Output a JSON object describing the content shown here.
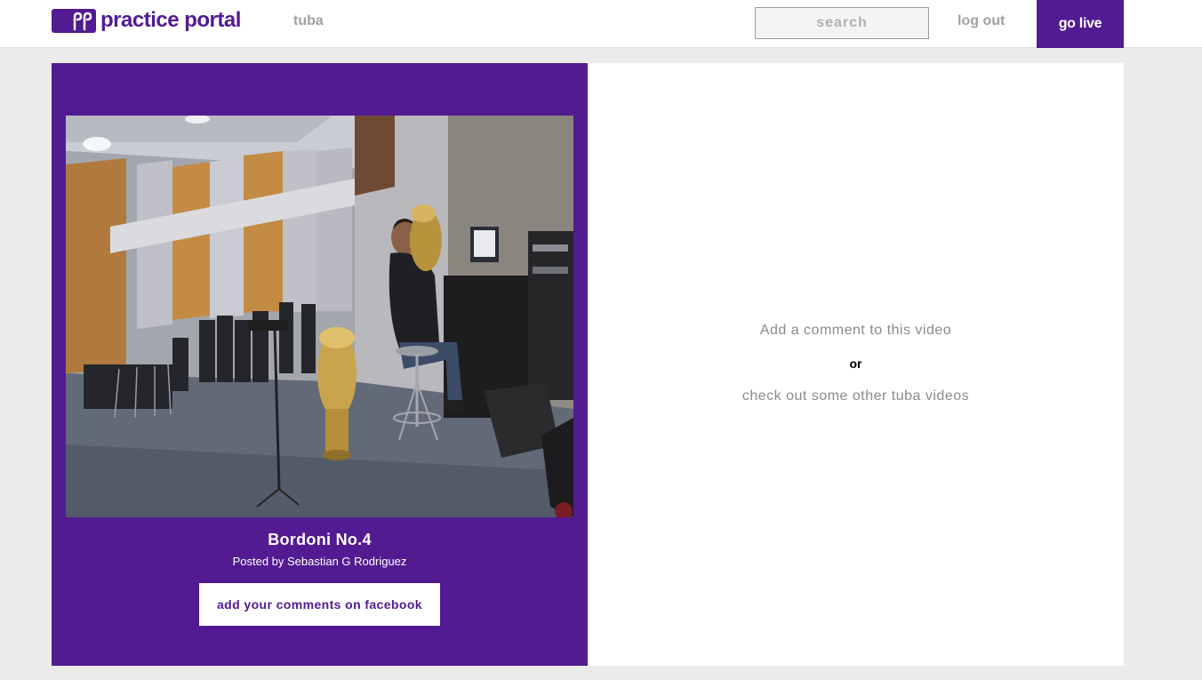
{
  "header": {
    "logo_text": "practice portal",
    "nav_instrument": "tuba",
    "search_placeholder": "search",
    "logout_label": "log out",
    "golive_label": "go live"
  },
  "video": {
    "title": "Bordoni No.4",
    "posted_by": "Posted by Sebastian G Rodriguez",
    "facebook_button": "add your comments on facebook"
  },
  "comments": {
    "add_comment": "Add a comment to this video",
    "or": "or",
    "other_videos": "check out some other tuba videos"
  },
  "colors": {
    "brand": "#521b91",
    "background": "#ebebeb",
    "muted_text": "#a1a1a1"
  }
}
